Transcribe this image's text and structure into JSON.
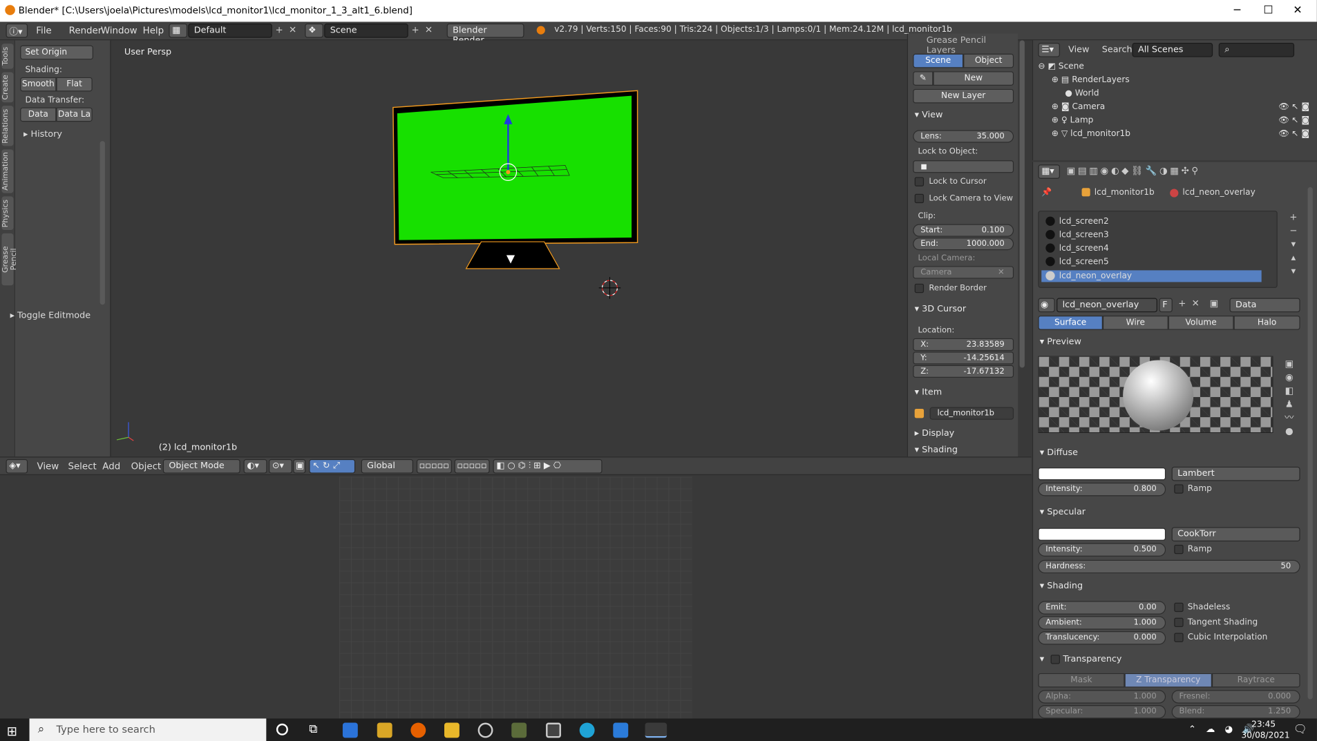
{
  "window": {
    "title": "Blender* [C:\\Users\\joela\\Pictures\\models\\lcd_monitor1\\lcd_monitor_1_3_alt1_6.blend]",
    "minimize": "─",
    "maximize": "☐",
    "close": "✕"
  },
  "menubar": {
    "items": [
      "File",
      "Render",
      "Window",
      "Help"
    ],
    "screen_layout": "Default",
    "scene": "Scene",
    "engine": "Blender Render",
    "stats": "v2.79 | Verts:150 | Faces:90 | Tris:224 | Objects:1/3 | Lamps:0/1 | Mem:24.12M | lcd_monitor1b"
  },
  "toolshelf": {
    "tabs": [
      "Tools",
      "Create",
      "Relations",
      "Animation",
      "Physics",
      "Grease Pencil"
    ],
    "set_origin": "Set Origin",
    "shading_label": "Shading:",
    "smooth": "Smooth",
    "flat": "Flat",
    "data_transfer_label": "Data Transfer:",
    "data": "Data",
    "data_la": "Data La",
    "history": "History",
    "toggle_editmode": "Toggle Editmode"
  },
  "viewport": {
    "view_label": "User Persp",
    "object_label": "(2) lcd_monitor1b",
    "colors": {
      "screen": "#17e000",
      "selection": "#f29a1e"
    }
  },
  "vpheader": {
    "view": "View",
    "select": "Select",
    "add": "Add",
    "object": "Object",
    "mode": "Object Mode",
    "orientation": "Global"
  },
  "npanel": {
    "grease_pencil_layers": "Grease Pencil Layers",
    "scene_btn": "Scene",
    "object_btn": "Object",
    "new_btn": "New",
    "new_layer": "New Layer",
    "view_header": "View",
    "lens_label": "Lens:",
    "lens_value": "35.000",
    "lock_to_object": "Lock to Object:",
    "lock_to_cursor": "Lock to Cursor",
    "lock_camera": "Lock Camera to View",
    "clip": "Clip:",
    "start_label": "Start:",
    "start_value": "0.100",
    "end_label": "End:",
    "end_value": "1000.000",
    "local_camera": "Local Camera:",
    "camera_value": "Camera",
    "render_border": "Render Border",
    "cursor_header": "3D Cursor",
    "location": "Location:",
    "x_label": "X:",
    "x_value": "23.83589",
    "y_label": "Y:",
    "y_value": "-14.25614",
    "z_label": "Z:",
    "z_value": "-17.67132",
    "item_header": "Item",
    "item_name": "lcd_monitor1b",
    "display_header": "Display",
    "shading_header": "Shading"
  },
  "outliner": {
    "view": "View",
    "search": "Search",
    "scenes": "All Scenes",
    "rows": [
      "Scene",
      "RenderLayers",
      "World",
      "Camera",
      "Lamp",
      "lcd_monitor1b"
    ]
  },
  "properties": {
    "breadcrumb_object": "lcd_monitor1b",
    "breadcrumb_material": "lcd_neon_overlay",
    "slots": [
      "lcd_screen2",
      "lcd_screen3",
      "lcd_screen4",
      "lcd_screen5",
      "lcd_neon_overlay"
    ],
    "material_name": "lcd_neon_overlay",
    "f_btn": "F",
    "data_dd": "Data",
    "tabs": [
      "Surface",
      "Wire",
      "Volume",
      "Halo"
    ],
    "preview": "Preview",
    "diffuse": "Diffuse",
    "diffuse_shader": "Lambert",
    "diffuse_intensity_label": "Intensity:",
    "diffuse_intensity": "0.800",
    "ramp": "Ramp",
    "specular": "Specular",
    "specular_shader": "CookTorr",
    "specular_intensity": "0.500",
    "hardness_label": "Hardness:",
    "hardness": "50",
    "shading": "Shading",
    "emit_label": "Emit:",
    "emit": "0.00",
    "ambient_label": "Ambient:",
    "ambient": "1.000",
    "translucency_label": "Translucency:",
    "translucency": "0.000",
    "shadeless": "Shadeless",
    "tangent_shading": "Tangent Shading",
    "cubic_interp": "Cubic Interpolation",
    "transparency": "Transparency",
    "mask": "Mask",
    "z_transparency": "Z Transparency",
    "raytrace": "Raytrace",
    "alpha_label": "Alpha:",
    "alpha": "1.000",
    "fresnel_label": "Fresnel:",
    "fresnel": "0.000",
    "specular_label": "Specular:",
    "specular_v": "1.000",
    "blend_label": "Blend:",
    "blend": "1.250"
  },
  "taskbar": {
    "search_placeholder": "Type here to search",
    "time": "23:45",
    "date": "30/08/2021"
  }
}
